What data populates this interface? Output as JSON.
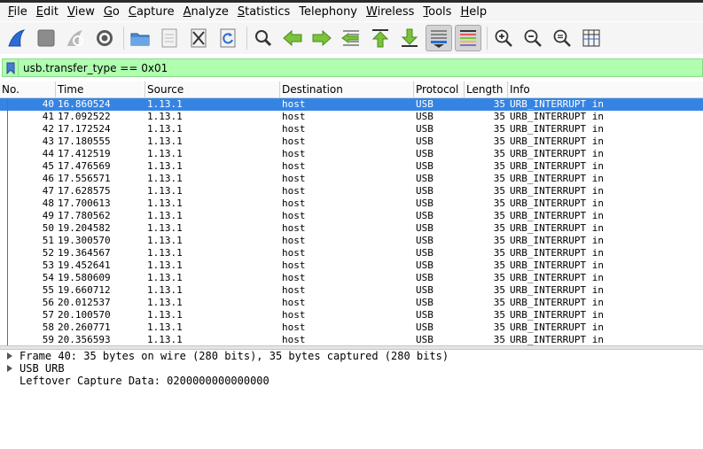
{
  "menubar": {
    "items": [
      {
        "first": "F",
        "rest": "ile"
      },
      {
        "first": "E",
        "rest": "dit"
      },
      {
        "first": "V",
        "rest": "iew"
      },
      {
        "first": "G",
        "rest": "o"
      },
      {
        "first": "C",
        "rest": "apture"
      },
      {
        "first": "A",
        "rest": "nalyze"
      },
      {
        "first": "S",
        "rest": "tatistics"
      },
      {
        "first": "",
        "rest": "Telephony"
      },
      {
        "first": "W",
        "rest": "ireless"
      },
      {
        "first": "T",
        "rest": "ools"
      },
      {
        "first": "H",
        "rest": "elp"
      }
    ]
  },
  "toolbar": {
    "icons": [
      "shark-fin-start-icon",
      "stop-capture-icon",
      "restart-capture-icon",
      "capture-options-gear-icon",
      "open-folder-icon",
      "save-file-icon",
      "close-file-icon",
      "reload-file-icon",
      "find-packet-icon",
      "go-back-icon",
      "go-forward-icon",
      "go-to-packet-icon",
      "go-first-packet-icon",
      "go-last-packet-icon",
      "auto-scroll-icon",
      "colorize-icon",
      "zoom-in-icon",
      "zoom-out-icon",
      "zoom-normal-icon",
      "resize-columns-icon"
    ]
  },
  "filter": {
    "value": "usb.transfer_type == 0x01"
  },
  "packet_list": {
    "columns": [
      "No.",
      "Time",
      "Source",
      "Destination",
      "Protocol",
      "Length",
      "Info"
    ],
    "rows": [
      {
        "no": "40",
        "time": "16.860524",
        "src": "1.13.1",
        "dst": "host",
        "proto": "USB",
        "len": "35",
        "info": "URB_INTERRUPT in"
      },
      {
        "no": "41",
        "time": "17.092522",
        "src": "1.13.1",
        "dst": "host",
        "proto": "USB",
        "len": "35",
        "info": "URB_INTERRUPT in"
      },
      {
        "no": "42",
        "time": "17.172524",
        "src": "1.13.1",
        "dst": "host",
        "proto": "USB",
        "len": "35",
        "info": "URB_INTERRUPT in"
      },
      {
        "no": "43",
        "time": "17.180555",
        "src": "1.13.1",
        "dst": "host",
        "proto": "USB",
        "len": "35",
        "info": "URB_INTERRUPT in"
      },
      {
        "no": "44",
        "time": "17.412519",
        "src": "1.13.1",
        "dst": "host",
        "proto": "USB",
        "len": "35",
        "info": "URB_INTERRUPT in"
      },
      {
        "no": "45",
        "time": "17.476569",
        "src": "1.13.1",
        "dst": "host",
        "proto": "USB",
        "len": "35",
        "info": "URB_INTERRUPT in"
      },
      {
        "no": "46",
        "time": "17.556571",
        "src": "1.13.1",
        "dst": "host",
        "proto": "USB",
        "len": "35",
        "info": "URB_INTERRUPT in"
      },
      {
        "no": "47",
        "time": "17.628575",
        "src": "1.13.1",
        "dst": "host",
        "proto": "USB",
        "len": "35",
        "info": "URB_INTERRUPT in"
      },
      {
        "no": "48",
        "time": "17.700613",
        "src": "1.13.1",
        "dst": "host",
        "proto": "USB",
        "len": "35",
        "info": "URB_INTERRUPT in"
      },
      {
        "no": "49",
        "time": "17.780562",
        "src": "1.13.1",
        "dst": "host",
        "proto": "USB",
        "len": "35",
        "info": "URB_INTERRUPT in"
      },
      {
        "no": "50",
        "time": "19.204582",
        "src": "1.13.1",
        "dst": "host",
        "proto": "USB",
        "len": "35",
        "info": "URB_INTERRUPT in"
      },
      {
        "no": "51",
        "time": "19.300570",
        "src": "1.13.1",
        "dst": "host",
        "proto": "USB",
        "len": "35",
        "info": "URB_INTERRUPT in"
      },
      {
        "no": "52",
        "time": "19.364567",
        "src": "1.13.1",
        "dst": "host",
        "proto": "USB",
        "len": "35",
        "info": "URB_INTERRUPT in"
      },
      {
        "no": "53",
        "time": "19.452641",
        "src": "1.13.1",
        "dst": "host",
        "proto": "USB",
        "len": "35",
        "info": "URB_INTERRUPT in"
      },
      {
        "no": "54",
        "time": "19.580609",
        "src": "1.13.1",
        "dst": "host",
        "proto": "USB",
        "len": "35",
        "info": "URB_INTERRUPT in"
      },
      {
        "no": "55",
        "time": "19.660712",
        "src": "1.13.1",
        "dst": "host",
        "proto": "USB",
        "len": "35",
        "info": "URB_INTERRUPT in"
      },
      {
        "no": "56",
        "time": "20.012537",
        "src": "1.13.1",
        "dst": "host",
        "proto": "USB",
        "len": "35",
        "info": "URB_INTERRUPT in"
      },
      {
        "no": "57",
        "time": "20.100570",
        "src": "1.13.1",
        "dst": "host",
        "proto": "USB",
        "len": "35",
        "info": "URB_INTERRUPT in"
      },
      {
        "no": "58",
        "time": "20.260771",
        "src": "1.13.1",
        "dst": "host",
        "proto": "USB",
        "len": "35",
        "info": "URB_INTERRUPT in"
      },
      {
        "no": "59",
        "time": "20.356593",
        "src": "1.13.1",
        "dst": "host",
        "proto": "USB",
        "len": "35",
        "info": "URB_INTERRUPT in"
      }
    ],
    "selected_index": 0
  },
  "details": {
    "items": [
      {
        "text": "Frame 40: 35 bytes on wire (280 bits), 35 bytes captured (280 bits)",
        "expandable": true
      },
      {
        "text": "USB URB",
        "expandable": true
      },
      {
        "text": "Leftover Capture Data: 0200000000000000",
        "expandable": false
      }
    ]
  },
  "colors": {
    "selection": "#3584e4",
    "filter_valid": "#afffaf",
    "accent_blue": "#2a6bd6"
  }
}
